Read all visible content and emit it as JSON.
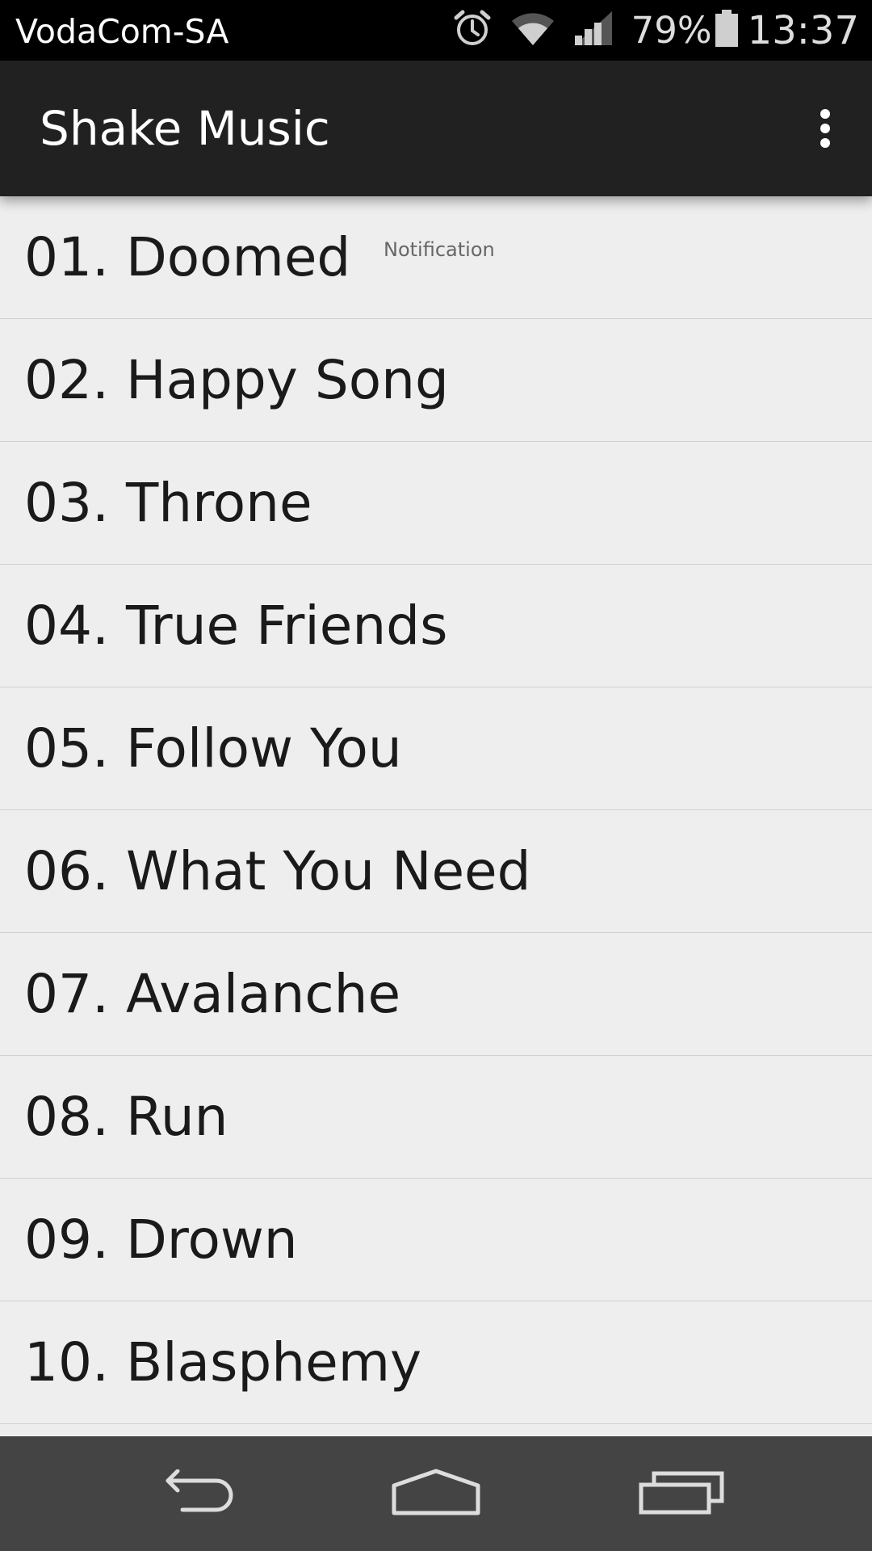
{
  "status_bar": {
    "carrier": "VodaCom-SA",
    "battery_percent": "79%",
    "time": "13:37",
    "icons": [
      "alarm-icon",
      "wifi-icon",
      "signal-icon",
      "battery-icon"
    ]
  },
  "action_bar": {
    "title": "Shake Music",
    "overflow_icon": "more-vert-icon"
  },
  "list": {
    "items": [
      {
        "label": "01. Doomed",
        "note": "Notification"
      },
      {
        "label": "02. Happy Song"
      },
      {
        "label": "03. Throne"
      },
      {
        "label": "04. True Friends"
      },
      {
        "label": "05. Follow You"
      },
      {
        "label": "06. What You Need"
      },
      {
        "label": "07. Avalanche"
      },
      {
        "label": "08. Run"
      },
      {
        "label": "09. Drown"
      },
      {
        "label": "10. Blasphemy"
      }
    ]
  },
  "nav_bar": {
    "icons": [
      "back-icon",
      "home-icon",
      "recents-icon"
    ]
  },
  "colors": {
    "status_bar_bg": "#000000",
    "action_bar_bg": "#212121",
    "list_bg": "#eeeeee",
    "nav_bar_bg": "#444444"
  }
}
